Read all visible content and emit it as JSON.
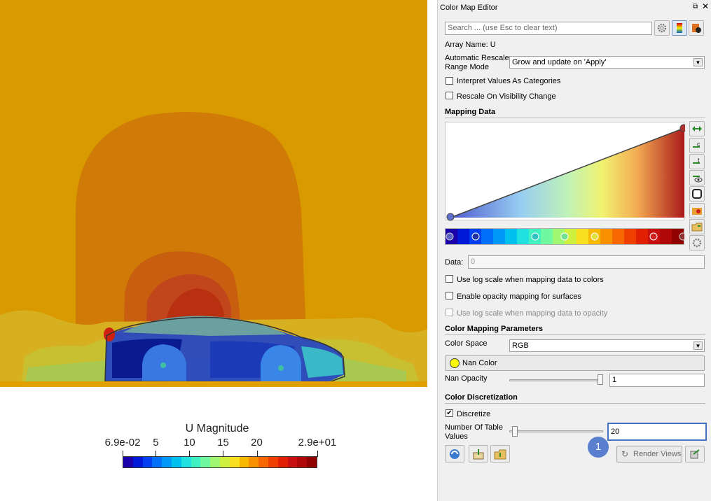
{
  "panel": {
    "title": "Color Map Editor",
    "search_placeholder": "Search ... (use Esc to clear text)",
    "array_name": "Array Name: U",
    "rescale_mode_label": "Automatic Rescale Range Mode",
    "rescale_mode_line1": "Automatic Rescale",
    "rescale_mode_line2": "Range Mode",
    "rescale_mode_value": "Grow and update on 'Apply'",
    "interpret_categories_label": "Interpret Values As Categories",
    "rescale_visibility_label": "Rescale On Visibility Change",
    "mapping_data_header": "Mapping Data",
    "data_label": "Data:",
    "data_value": "0",
    "log_scale_colors_label": "Use log scale when mapping data to colors",
    "opacity_mapping_label": "Enable opacity mapping for surfaces",
    "log_scale_opacity_label": "Use log scale when mapping data to opacity",
    "color_mapping_header": "Color Mapping Parameters",
    "color_space_label": "Color Space",
    "color_space_value": "RGB",
    "nan_color_label": "Nan Color",
    "nan_color": "#ffff00",
    "nan_opacity_label": "Nan Opacity",
    "nan_opacity_value": "1",
    "color_discretization_header": "Color Discretization",
    "discretize_label": "Discretize",
    "discretize_checked": true,
    "table_values_line1": "Number Of Table",
    "table_values_line2": "Values",
    "table_values_value": "20",
    "render_views_label": "Render Views",
    "callout_number": "1"
  },
  "colorbar": {
    "title": "U Magnitude",
    "tick_labels": [
      "6.9e-02",
      "5",
      "10",
      "15",
      "20",
      "2.9e+01"
    ],
    "tick_values": [
      0.069,
      5,
      10,
      15,
      20,
      29
    ],
    "range": [
      0.069,
      29
    ],
    "colors": [
      "#1a00a8",
      "#0018d8",
      "#0040f0",
      "#0070f8",
      "#0098f8",
      "#00c0f0",
      "#20e0e0",
      "#40f0c0",
      "#70f8a0",
      "#a0f870",
      "#d0f040",
      "#f8e020",
      "#f8b800",
      "#f89000",
      "#f86800",
      "#f04000",
      "#e02000",
      "#c81010",
      "#b00808",
      "#900000"
    ]
  },
  "icons": {
    "gear": "gear-icon",
    "colormap_preset": "colormap-preset-icon",
    "advanced": "advanced-icon",
    "restore": "restore-window-icon",
    "close": "close-icon"
  },
  "colors": {
    "accent": "#4472c4",
    "callout": "#5b7fcf"
  }
}
